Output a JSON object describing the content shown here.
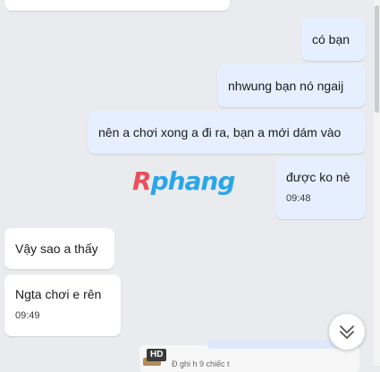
{
  "messages": [
    {
      "id": "m1",
      "direction": "out",
      "text": "có bạn"
    },
    {
      "id": "m2",
      "direction": "out",
      "text": "nhwung bạn nó ngaij"
    },
    {
      "id": "m3",
      "direction": "out",
      "text": "nên a chơi xong a đi ra, bạn a mới dám vào"
    },
    {
      "id": "m4",
      "direction": "out",
      "text": "được ko nè",
      "time": "09:48"
    },
    {
      "id": "m5",
      "direction": "in",
      "text": "Vậy sao a thấy"
    },
    {
      "id": "m6",
      "direction": "in",
      "text": "Ngta chơi e rên",
      "time": "09:49"
    }
  ],
  "watermark": {
    "r": "R",
    "rest": "phang"
  },
  "attachment": {
    "badge": "HD",
    "partial_text": "Đ ghi h 9 chiếc t"
  },
  "icons": {
    "scroll_down": "double-chevron-down-icon"
  },
  "colors": {
    "background": "#e9ebee",
    "outgoing_bubble": "#e5efff",
    "incoming_bubble": "#ffffff",
    "watermark_red": "#e8505b",
    "watermark_blue": "#2aa6e8"
  }
}
